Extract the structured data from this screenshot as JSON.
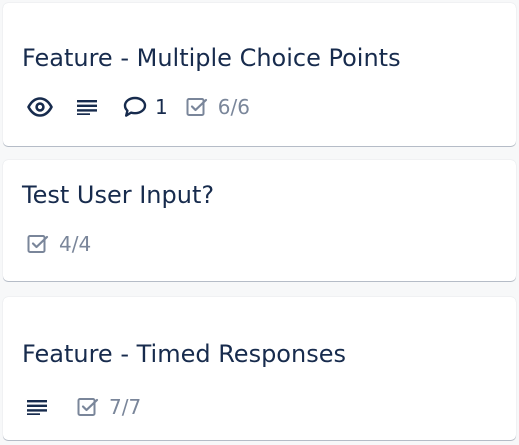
{
  "cards": [
    {
      "title": "Feature - Multiple Choice Points",
      "comments_count": "1",
      "checklist": "6/6"
    },
    {
      "title": "Test User Input?",
      "checklist": "4/4"
    },
    {
      "title": "Feature - Timed Responses",
      "checklist": "7/7"
    }
  ],
  "colors": {
    "text": "#172b4d",
    "muted": "#7a869a",
    "card_bg": "#ffffff",
    "board_bg": "#f7f8f9"
  }
}
